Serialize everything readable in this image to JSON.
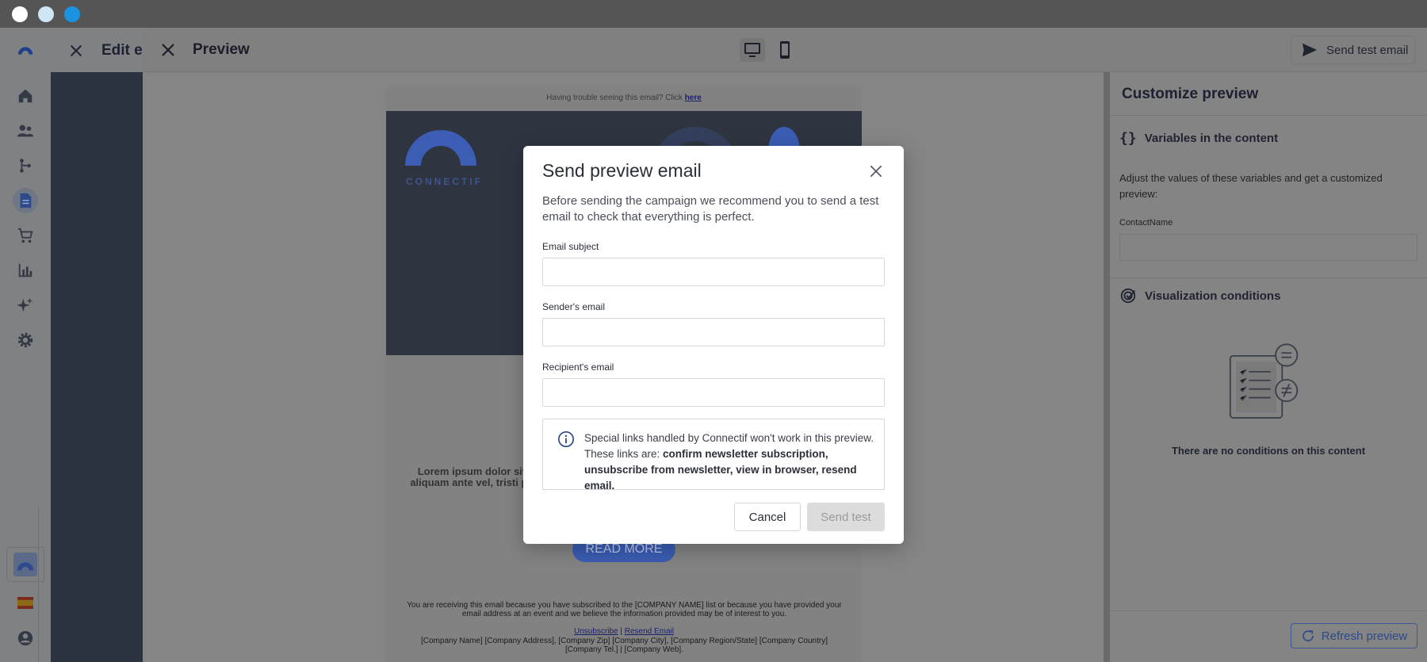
{
  "window": {
    "controls": [
      "close",
      "minimize",
      "maximize"
    ]
  },
  "nav": {
    "items": [
      "home-icon",
      "contacts-icon",
      "workflows-icon",
      "content-icon",
      "catalog-icon",
      "analytics-icon",
      "ai-icon",
      "settings-icon"
    ],
    "active": "content-icon"
  },
  "editor": {
    "title": "Edit email"
  },
  "preview": {
    "title": "Preview",
    "send_test_label": "Send test email"
  },
  "email": {
    "trouble_text": "Having trouble seeing this email? Click ",
    "trouble_link": "here",
    "brand": "CONNECTIF",
    "lorem": "Lorem ipsum dolor sit aliquam ante vel, tristi pe",
    "read_more": "READ MORE",
    "footer_text": "You are receiving this email because you have subscribed to the [COMPANY NAME] list or because you have provided your email address at an event and we believe the information provided may be of interest to you.",
    "unsubscribe": "Unsubscribe",
    "separator": "|",
    "resend": "Resend Email",
    "address": "[Company Name] [Company Address], [Company Zip] [Company City], [Company Region/State] [Company Country] [Company Tel.] | [Company Web]."
  },
  "sidebar": {
    "title": "Customize preview",
    "variables_title": "Variables in the content",
    "variables_desc": "Adjust the values of these variables and get a customized preview:",
    "contact_name_label": "ContactName",
    "conditions_title": "Visualization conditions",
    "no_conditions": "There are no conditions on this content",
    "refresh_label": "Refresh preview"
  },
  "modal": {
    "title": "Send preview email",
    "description": "Before sending the campaign we recommend you to send a test email to check that everything is perfect.",
    "subject_label": "Email subject",
    "subject_value": "",
    "sender_label": "Sender's email",
    "sender_value": "",
    "recipient_label": "Recipient's email",
    "recipient_value": "",
    "info_text": "Special links handled by Connectif won't work in this preview. These links are: ",
    "info_bold": "confirm newsletter subscription, unsubscribe from newsletter, view in browser, resend email.",
    "cancel_label": "Cancel",
    "send_label": "Send test"
  },
  "colors": {
    "accent": "#2d4a8a",
    "brand_blue": "#3b5db3",
    "disabled_button": "#dcdcdc"
  }
}
